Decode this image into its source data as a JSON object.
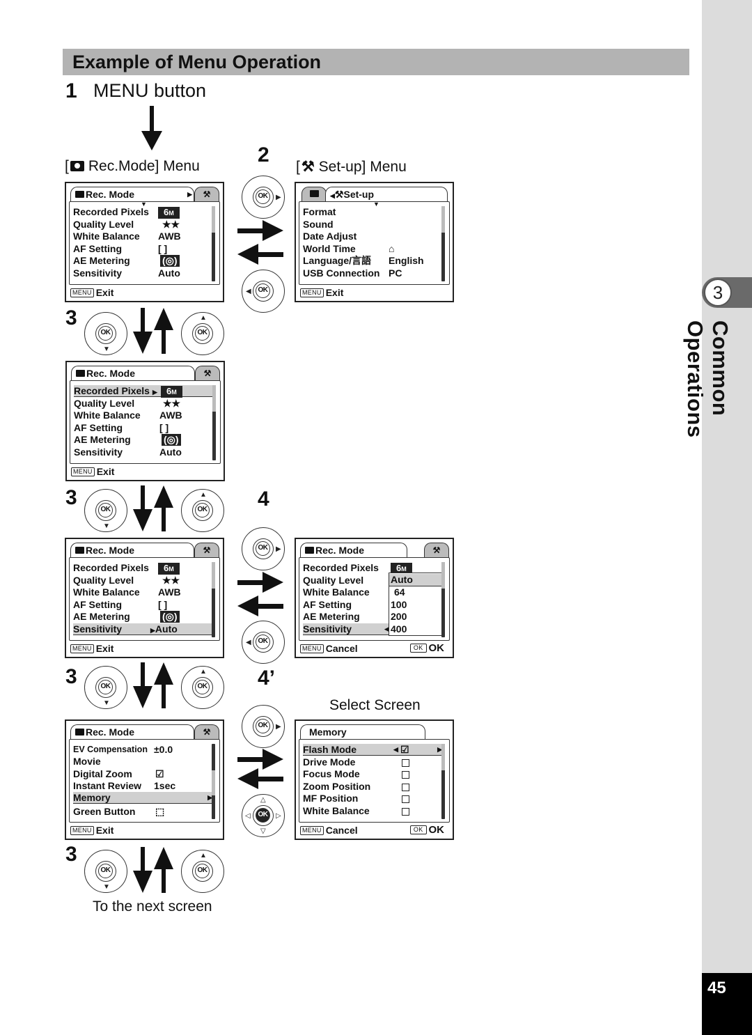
{
  "page": {
    "section_title": "Example of Menu Operation",
    "chapter_number": "3",
    "chapter_title": "Common Operations",
    "page_number": "45"
  },
  "steps": {
    "step1": {
      "number": "1",
      "label": "MENU button"
    },
    "step2": {
      "number": "2"
    },
    "step3": {
      "number": "3"
    },
    "step4": {
      "number": "4"
    },
    "step4prime": {
      "number": "4’"
    }
  },
  "captions": {
    "rec_mode_menu": "Rec.Mode] Menu",
    "rec_mode_bracket": "[",
    "setup_menu": "Set-up] Menu",
    "setup_bracket": "[",
    "select_screen": "Select Screen",
    "next_screen": "To the next screen"
  },
  "icons": {
    "camera": "camera-icon",
    "wrench": "setup-wrench-icon",
    "ok_dial": "ok-button-icon",
    "arrow_down": "arrow-down-icon",
    "arrow_up": "arrow-up-icon",
    "arrow_right": "arrow-right-icon",
    "arrow_left": "arrow-left-icon"
  },
  "screens": {
    "rec1": {
      "tab": "Rec. Mode",
      "rows": [
        {
          "label": "Recorded Pixels",
          "value": "6M"
        },
        {
          "label": "Quality Level",
          "value": "★★"
        },
        {
          "label": "White Balance",
          "value": "AWB"
        },
        {
          "label": "AF Setting",
          "value": "[  ]"
        },
        {
          "label": "AE Metering",
          "value": "(◎)"
        },
        {
          "label": "Sensitivity",
          "value": "Auto"
        }
      ],
      "footer_key": "MENU",
      "footer_label": "Exit"
    },
    "setup": {
      "tab": "Set-up",
      "rows": [
        {
          "label": "Format",
          "value": ""
        },
        {
          "label": "Sound",
          "value": ""
        },
        {
          "label": "Date Adjust",
          "value": ""
        },
        {
          "label": "World Time",
          "value": "⌂"
        },
        {
          "label": "Language/言語",
          "value": "English"
        },
        {
          "label": "USB Connection",
          "value": "PC"
        }
      ],
      "footer_key": "MENU",
      "footer_label": "Exit"
    },
    "rec2": {
      "tab": "Rec. Mode",
      "selected": "Recorded Pixels",
      "rows": [
        {
          "label": "Recorded Pixels",
          "value": "6M"
        },
        {
          "label": "Quality Level",
          "value": "★★"
        },
        {
          "label": "White Balance",
          "value": "AWB"
        },
        {
          "label": "AF Setting",
          "value": "[  ]"
        },
        {
          "label": "AE Metering",
          "value": "(◎)"
        },
        {
          "label": "Sensitivity",
          "value": "Auto"
        }
      ],
      "footer_key": "MENU",
      "footer_label": "Exit"
    },
    "rec3": {
      "tab": "Rec. Mode",
      "selected": "Sensitivity",
      "rows": [
        {
          "label": "Recorded Pixels",
          "value": "6M"
        },
        {
          "label": "Quality Level",
          "value": "★★"
        },
        {
          "label": "White Balance",
          "value": "AWB"
        },
        {
          "label": "AF Setting",
          "value": "[  ]"
        },
        {
          "label": "AE Metering",
          "value": "(◎)"
        },
        {
          "label": "Sensitivity",
          "value": "Auto"
        }
      ],
      "footer_key": "MENU",
      "footer_label": "Exit"
    },
    "sensitivity": {
      "tab": "Rec. Mode",
      "rows": [
        {
          "label": "Recorded Pixels",
          "value": "6M"
        },
        {
          "label": "Quality Level"
        },
        {
          "label": "White Balance"
        },
        {
          "label": "AF Setting"
        },
        {
          "label": "AE Metering"
        },
        {
          "label": "Sensitivity"
        }
      ],
      "options": [
        "Auto",
        "64",
        "100",
        "200",
        "400"
      ],
      "selected_option": "Auto",
      "footer_key": "MENU",
      "footer_label": "Cancel",
      "ok_key": "OK",
      "ok_label": "OK"
    },
    "rec4": {
      "tab": "Rec. Mode",
      "selected": "Memory",
      "rows": [
        {
          "label": "EV Compensation",
          "value": "±0.0"
        },
        {
          "label": "Movie",
          "value": ""
        },
        {
          "label": "Digital Zoom",
          "value": "☑"
        },
        {
          "label": "Instant Review",
          "value": "1sec"
        },
        {
          "label": "Memory",
          "value": ""
        },
        {
          "label": "Green Button",
          "value": "⬚"
        }
      ],
      "footer_key": "MENU",
      "footer_label": "Exit"
    },
    "memory": {
      "tab": "Memory",
      "selected": "Flash Mode",
      "rows": [
        {
          "label": "Flash Mode",
          "checked": true
        },
        {
          "label": "Drive Mode",
          "checked": false
        },
        {
          "label": "Focus Mode",
          "checked": false
        },
        {
          "label": "Zoom Position",
          "checked": false
        },
        {
          "label": "MF Position",
          "checked": false
        },
        {
          "label": "White Balance",
          "checked": false
        }
      ],
      "footer_key": "MENU",
      "footer_label": "Cancel",
      "ok_key": "OK",
      "ok_label": "OK"
    }
  },
  "dial_label": "OK"
}
